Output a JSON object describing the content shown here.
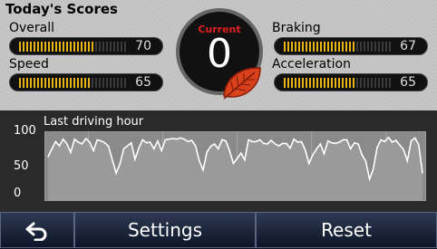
{
  "title": "Today's Scores",
  "metrics": {
    "overall": {
      "label": "Overall",
      "value": "70",
      "level": 70
    },
    "speed": {
      "label": "Speed",
      "value": "65",
      "level": 65
    },
    "braking": {
      "label": "Braking",
      "value": "67",
      "level": 67
    },
    "acceleration": {
      "label": "Acceleration",
      "value": "65",
      "level": 65
    }
  },
  "current": {
    "label": "Current",
    "value": "0"
  },
  "chart": {
    "title": "Last driving hour",
    "y_ticks": [
      "100",
      "50",
      "0"
    ]
  },
  "chart_data": {
    "type": "line",
    "title": "Last driving hour",
    "xlabel": "",
    "ylabel": "",
    "ylim": [
      0,
      100
    ],
    "y_ticks": [
      100,
      50,
      0
    ],
    "grid": true,
    "series": [
      {
        "values": [
          67,
          80,
          92,
          85,
          96,
          88,
          74,
          96,
          91,
          88,
          97,
          91,
          77,
          95,
          93,
          90,
          84,
          62,
          40,
          55,
          80,
          85,
          90,
          63,
          81,
          95,
          90,
          91,
          80,
          93,
          77,
          95,
          96,
          97,
          96,
          98,
          96,
          92,
          94,
          85,
          60,
          45,
          75,
          84,
          88,
          80,
          95,
          93,
          77,
          56,
          64,
          73,
          62,
          95,
          92,
          92,
          95,
          89,
          88,
          94,
          88,
          85,
          89,
          89,
          81,
          96,
          91,
          92,
          78,
          56,
          70,
          80,
          88,
          72,
          93,
          90,
          89,
          91,
          95,
          95,
          80,
          90,
          88,
          70,
          60,
          30,
          47,
          82,
          95,
          92,
          99,
          91,
          94,
          86,
          79,
          60,
          93,
          98,
          87,
          40
        ]
      }
    ]
  },
  "buttons": {
    "back_icon": "back-arrow-icon",
    "settings": "Settings",
    "reset": "Reset"
  },
  "colors": {
    "meter_fill": "#e7b418",
    "current_label": "#e02020",
    "leaf": "#d9401c"
  }
}
